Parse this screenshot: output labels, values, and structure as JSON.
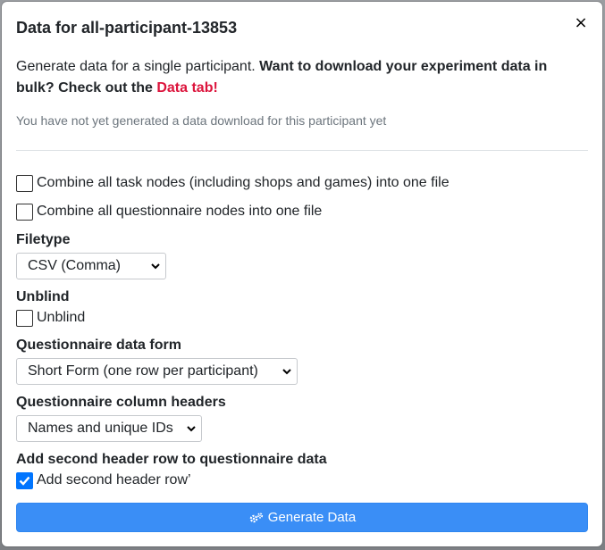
{
  "modal": {
    "title": "Data for all-participant-13853",
    "close_symbol": "×"
  },
  "intro": {
    "plain": "Generate data for a single participant. ",
    "bold": "Want to download your experiment data in bulk? Check out the ",
    "link": "Data tab!"
  },
  "status": "You have not yet generated a data download for this participant yet",
  "options": {
    "combine_tasks": {
      "label": "Combine all task nodes (including shops and games) into one file",
      "checked": false
    },
    "combine_questionnaires": {
      "label": "Combine all questionnaire nodes into one file",
      "checked": false
    }
  },
  "filetype": {
    "label": "Filetype",
    "selected": "CSV (Comma)"
  },
  "unblind": {
    "label": "Unblind",
    "checkbox_label": "Unblind",
    "checked": false
  },
  "questionnaire_form": {
    "label": "Questionnaire data form",
    "selected": "Short Form (one row per participant)"
  },
  "column_headers": {
    "label": "Questionnaire column headers",
    "selected": "Names and unique IDs"
  },
  "second_header": {
    "label": "Add second header row to questionnaire data",
    "checkbox_label": "Add second header row’",
    "checked": true
  },
  "generate_button": {
    "label": "Generate Data",
    "icon": "gears-icon"
  },
  "colors": {
    "primary": "#3a8ef6",
    "link": "#dc143c",
    "muted": "#6c757d"
  }
}
